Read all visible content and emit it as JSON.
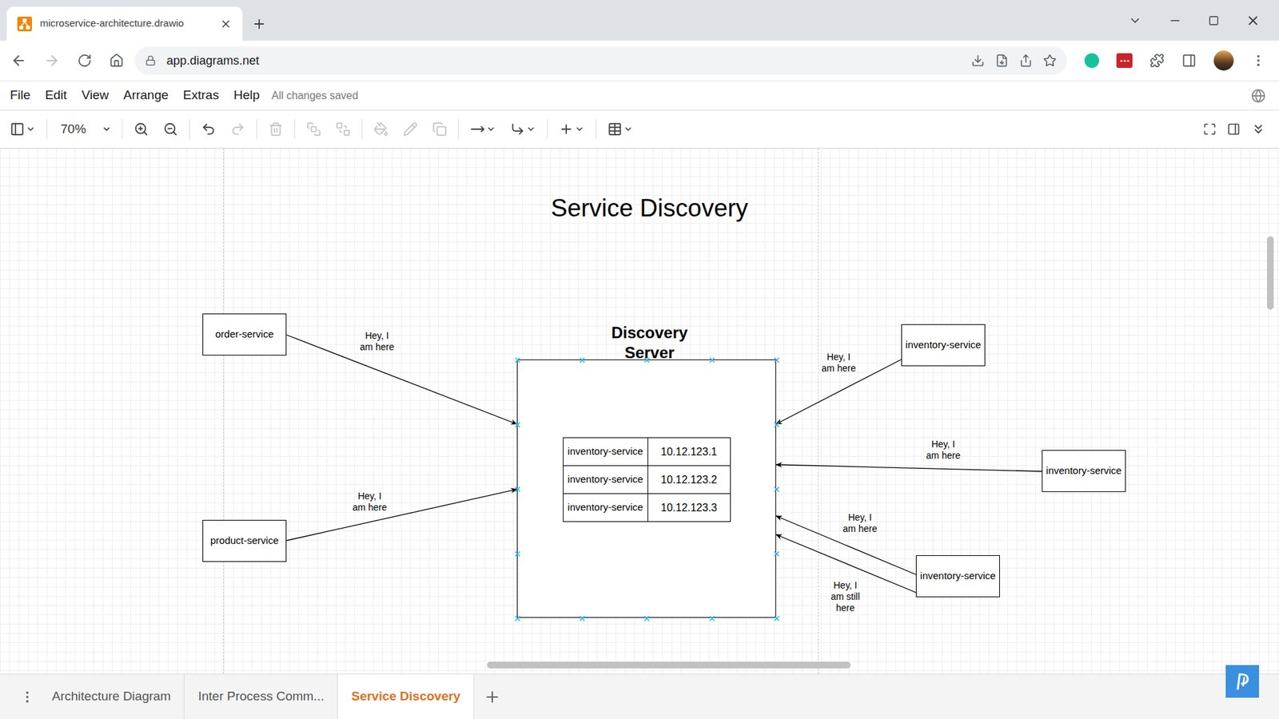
{
  "browser": {
    "tab_title": "microservice-architecture.drawio",
    "url": "app.diagrams.net"
  },
  "menu": [
    "File",
    "Edit",
    "View",
    "Arrange",
    "Extras",
    "Help"
  ],
  "save_status": "All changes saved",
  "toolbar": {
    "zoom": "70%",
    "tools": [
      {
        "disabled": false
      },
      {
        "disabled": false
      },
      {
        "disabled": false
      },
      {
        "disabled": false
      },
      {
        "disabled": true
      },
      {
        "disabled": true
      },
      {
        "disabled": true
      },
      {
        "disabled": true
      },
      {
        "disabled": true
      },
      {
        "disabled": true
      },
      {
        "disabled": true
      },
      {
        "disabled": false
      },
      {
        "disabled": false
      },
      {
        "disabled": false
      },
      {
        "disabled": false
      }
    ]
  },
  "diagram": {
    "title": "Service Discovery",
    "server": {
      "label": "Discovery Server",
      "selected": true,
      "registry": [
        {
          "name": "inventory-service",
          "ip": "10.12.123.1"
        },
        {
          "name": "inventory-service",
          "ip": "10.12.123.2"
        },
        {
          "name": "inventory-service",
          "ip": "10.12.123.3"
        }
      ]
    },
    "services": [
      {
        "label": "order-service"
      },
      {
        "label": "product-service"
      },
      {
        "label": "inventory-service"
      },
      {
        "label": "inventory-service"
      },
      {
        "label": "inventory-service"
      }
    ],
    "edges": [
      {
        "label": "Hey, I\nam here"
      },
      {
        "label": "Hey, I\nam here"
      },
      {
        "label": "Hey, I\nam here"
      },
      {
        "label": "Hey, I\nam here"
      },
      {
        "label": "Hey, I\nam here"
      },
      {
        "label": "Hey, I\nam still\nhere"
      }
    ]
  },
  "pages": [
    {
      "label": "Architecture Diagram",
      "selected": false
    },
    {
      "label": "Inter Process Comm...",
      "selected": false
    },
    {
      "label": "Service Discovery",
      "selected": true
    }
  ]
}
